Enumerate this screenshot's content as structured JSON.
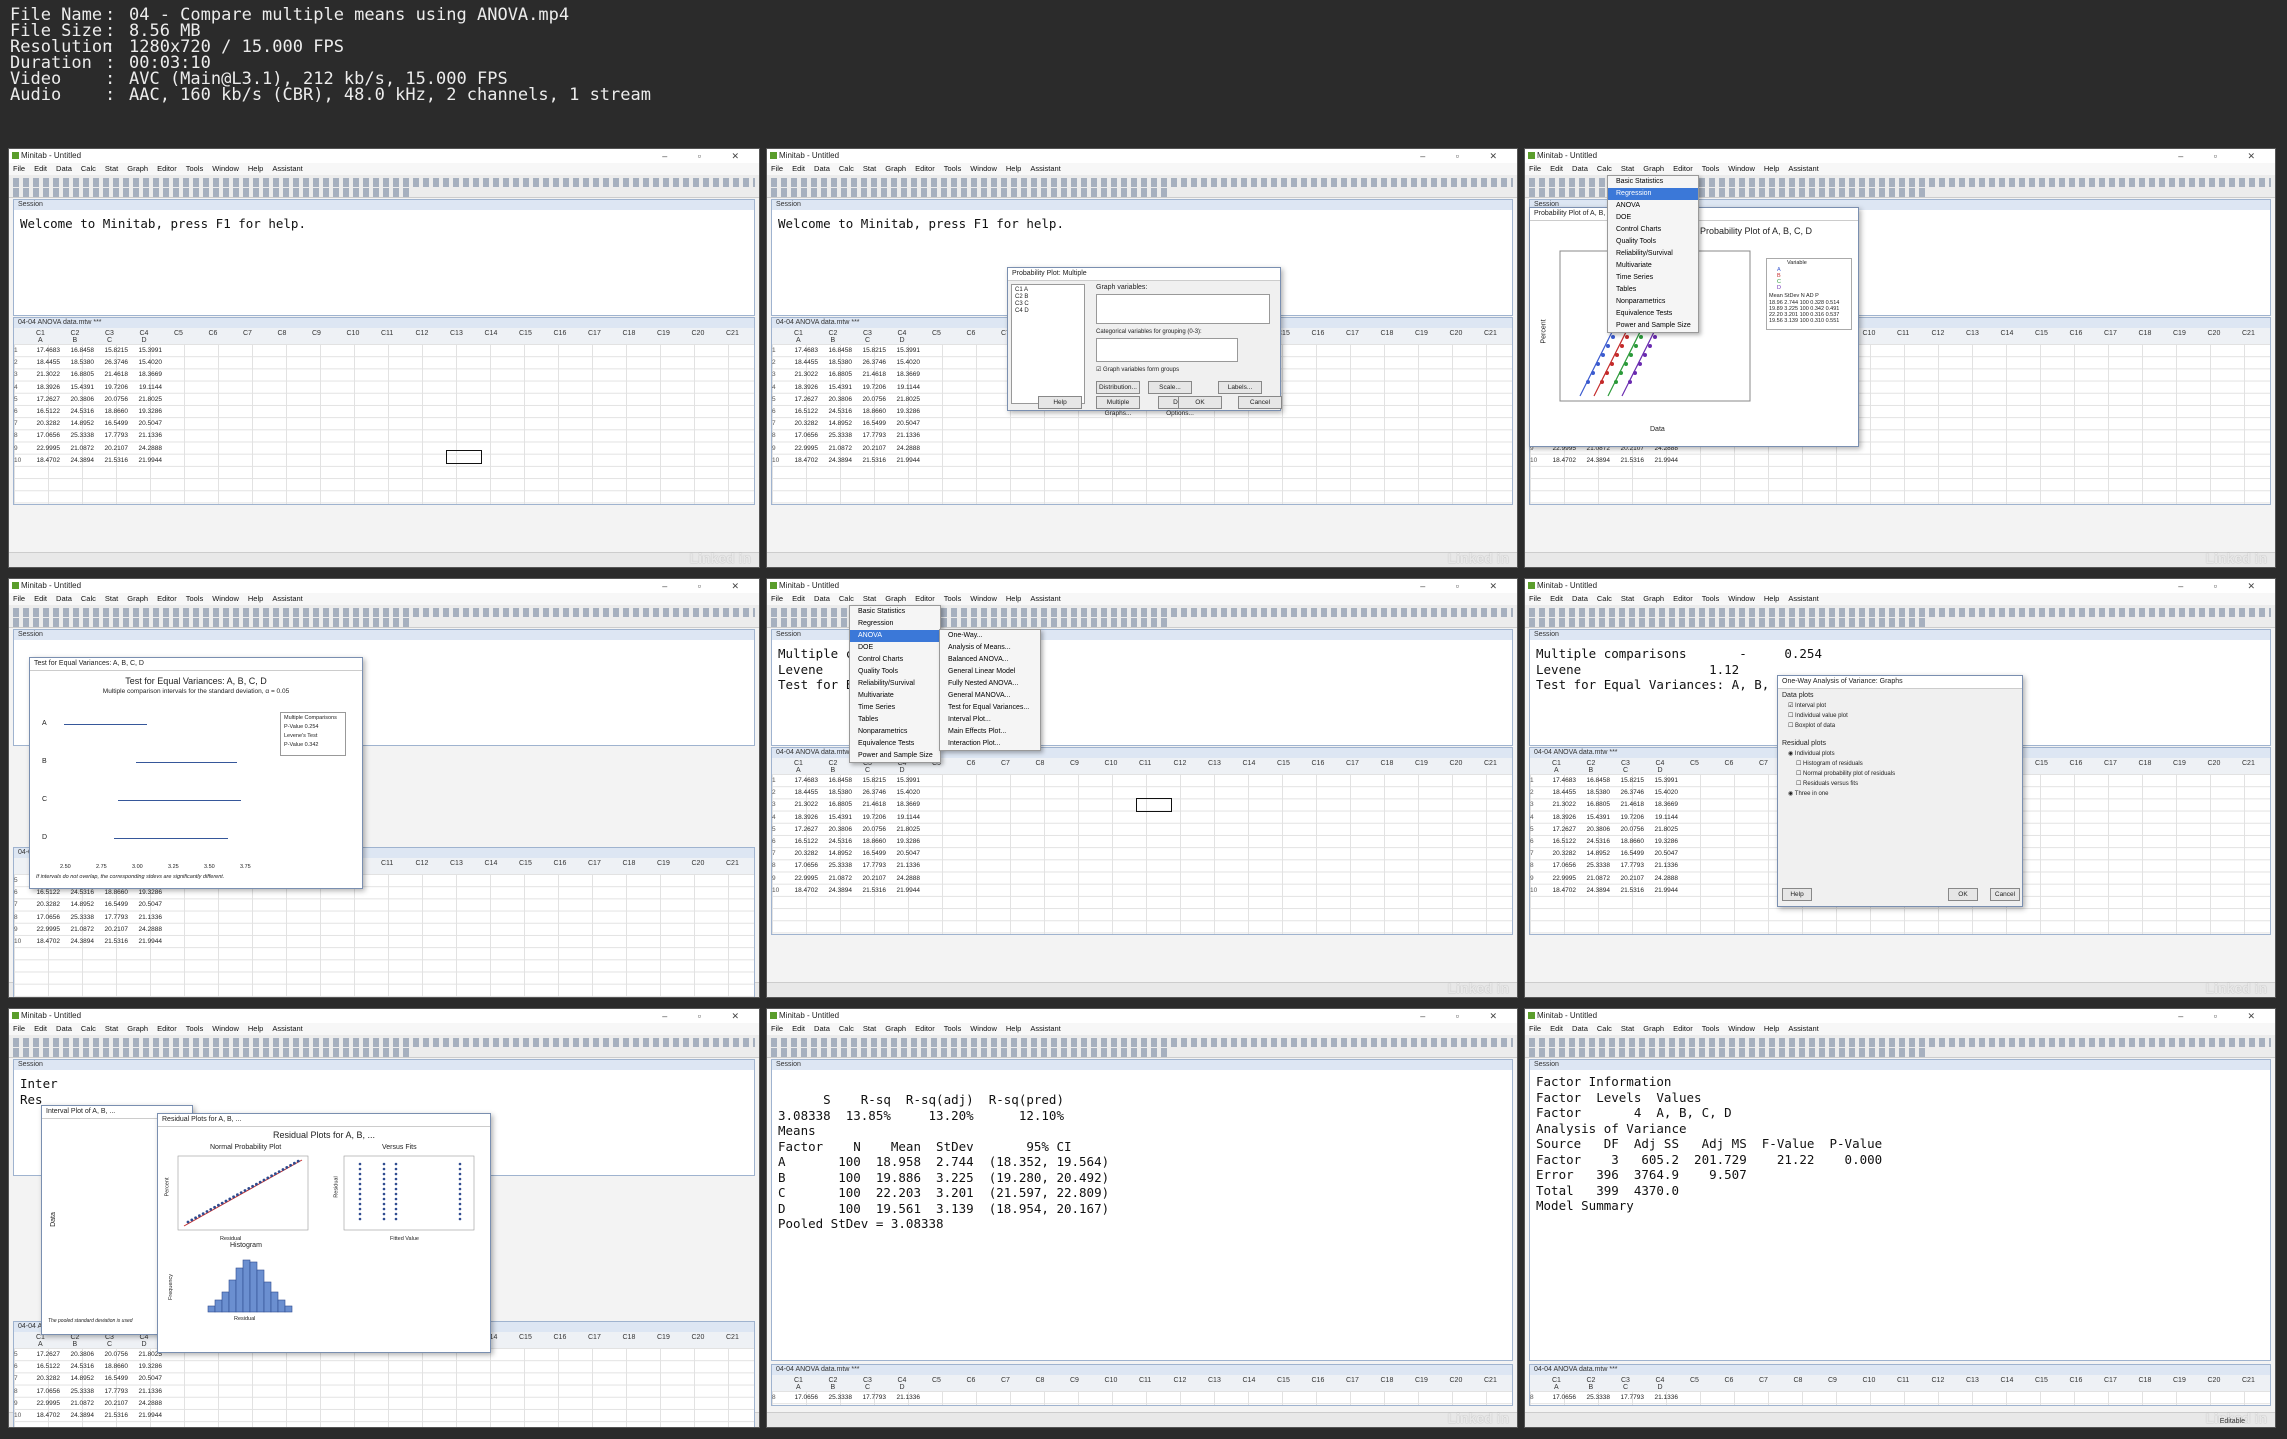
{
  "file_info": [
    {
      "key": "File Name",
      "value": "04 - Compare multiple means using ANOVA.mp4"
    },
    {
      "key": "File Size",
      "value": "8.56 MB"
    },
    {
      "key": "Resolution",
      "value": "1280x720 / 15.000 FPS"
    },
    {
      "key": "Duration",
      "value": "00:03:10"
    },
    {
      "key": "Video",
      "value": "AVC (Main@L3.1), 212 kb/s, 15.000 FPS"
    },
    {
      "key": "Audio",
      "value": "AAC, 160 kb/s (CBR), 48.0 kHz, 2 channels, 1 stream"
    }
  ],
  "app": {
    "title": "Minitab - Untitled",
    "menus": [
      "File",
      "Edit",
      "Data",
      "Calc",
      "Stat",
      "Graph",
      "Editor",
      "Tools",
      "Window",
      "Help",
      "Assistant"
    ],
    "session_title": "Session",
    "worksheet_title": "04-04 ANOVA data.mtw ***",
    "watermark": "Linked in"
  },
  "session_text": {
    "welcome": "Welcome to Minitab, press F1 for help.",
    "multiple": "Multiple comparisons",
    "levene": "Levene",
    "levene_val": "1.12",
    "pval": "0.254",
    "test_equal": "Test for Equal Variances: A, B,"
  },
  "worksheet": {
    "columns": [
      "C1",
      "C2",
      "C3",
      "C4",
      "C5",
      "C6",
      "C7",
      "C8",
      "C9",
      "C10",
      "C11",
      "C12",
      "C13",
      "C14",
      "C15",
      "C16",
      "C17",
      "C18",
      "C19",
      "C20",
      "C21"
    ],
    "names": [
      "A",
      "B",
      "C",
      "D"
    ],
    "rows": [
      [
        "1",
        "17.4683",
        "16.8458",
        "15.8215",
        "15.3991"
      ],
      [
        "2",
        "18.4455",
        "18.5380",
        "26.3746",
        "15.4020"
      ],
      [
        "3",
        "21.3022",
        "16.8805",
        "21.4618",
        "18.3669"
      ],
      [
        "4",
        "18.3926",
        "15.4391",
        "19.7206",
        "19.1144"
      ],
      [
        "5",
        "17.2627",
        "20.3806",
        "20.0756",
        "21.8025"
      ],
      [
        "6",
        "16.5122",
        "24.5316",
        "18.8660",
        "19.3286"
      ],
      [
        "7",
        "20.3282",
        "14.8952",
        "16.5499",
        "20.5047"
      ],
      [
        "8",
        "17.0656",
        "25.3338",
        "17.7793",
        "21.1336"
      ],
      [
        "9",
        "22.9995",
        "21.0872",
        "20.2107",
        "24.2888"
      ],
      [
        "10",
        "18.4702",
        "24.3894",
        "21.5316",
        "21.9944"
      ]
    ]
  },
  "stat_menu": [
    "Basic Statistics",
    "Regression",
    "ANOVA",
    "DOE",
    "Control Charts",
    "Quality Tools",
    "Reliability/Survival",
    "Multivariate",
    "Time Series",
    "Tables",
    "Nonparametrics",
    "Equivalence Tests",
    "Power and Sample Size"
  ],
  "anova_submenu": [
    "One-Way...",
    "Analysis of Means...",
    "Balanced ANOVA...",
    "General Linear Model",
    "Fully Nested ANOVA...",
    "General MANOVA...",
    "Test for Equal Variances...",
    "Interval Plot...",
    "Main Effects Plot...",
    "Interaction Plot..."
  ],
  "prob_dialog": {
    "title": "Probability Plot: Multiple",
    "vars": [
      "C1  A",
      "C2  B",
      "C3  C",
      "C4  D"
    ],
    "graph_vars": "Graph variables:",
    "cat_vars": "Categorical variables for grouping (0-3):",
    "check": "Graph variables form groups",
    "buttons": [
      "Distribution...",
      "Scale...",
      "Labels...",
      "Multiple Graphs...",
      "Data Options...",
      "Select",
      "Help",
      "OK",
      "Cancel"
    ]
  },
  "prob_plot": {
    "title": "Probability Plot of A, B, C, D",
    "xlabel": "Data",
    "ylabel": "Percent",
    "legend_title": "Variable",
    "legend": [
      "A",
      "B",
      "C",
      "D"
    ],
    "stats_header": [
      "Mean",
      "StDev",
      "N",
      "AD",
      "P"
    ],
    "stats": [
      [
        "18.96",
        "2.744",
        "100",
        "0.328",
        "0.514"
      ],
      [
        "19.89",
        "3.225",
        "100",
        "0.342",
        "0.491"
      ],
      [
        "22.20",
        "3.201",
        "100",
        "0.316",
        "0.537"
      ],
      [
        "19.56",
        "3.139",
        "100",
        "0.310",
        "0.551"
      ]
    ]
  },
  "equal_var": {
    "window_title": "Test for Equal Variances: A, B, C, D",
    "title": "Test for Equal Variances: A, B, C, D",
    "subtitle": "Multiple comparison intervals for the standard deviation, α = 0.05",
    "box": [
      "Multiple Comparisons",
      "P-Value   0.254",
      "Levene's Test",
      "P-Value   0.342"
    ],
    "groups": [
      "A",
      "B",
      "C",
      "D"
    ],
    "ticks": [
      "2.50",
      "2.75",
      "3.00",
      "3.25",
      "3.50",
      "3.75"
    ],
    "footnote": "If intervals do not overlap, the corresponding stdevs are significantly different."
  },
  "oneway_graphs": {
    "title": "One-Way Analysis of Variance: Graphs",
    "data_plots": "Data plots",
    "options1": [
      "Interval plot",
      "Individual value plot",
      "Boxplot of data"
    ],
    "resid_plots": "Residual plots",
    "options2": [
      "Individual plots",
      "Histogram of residuals",
      "Normal probability plot of residuals",
      "Residuals versus fits",
      "Three in one"
    ],
    "buttons": [
      "Help",
      "OK",
      "Cancel"
    ]
  },
  "residual": {
    "window_title": "Residual Plots for A, B, ...",
    "interval_title": "Interval Plot of A, B, ...",
    "title": "Residual Plots for A, B, ...",
    "npp": "Normal Probability Plot",
    "vfits": "Versus Fits",
    "hist": "Histogram",
    "xl1": "Residual",
    "xl2": "Fitted Value",
    "yl1": "Percent",
    "yl2": "Residual",
    "yl3": "Frequency",
    "data_label": "Data",
    "pooled_note": "The pooled standard deviation is used",
    "inter": "Inter",
    "res": "Res"
  },
  "summary": {
    "header": "      S    R-sq  R-sq(adj)  R-sq(pred)",
    "row": "3.08338  13.85%     13.20%      12.10%",
    "means": "Means",
    "mhead": "Factor    N    Mean  StDev       95% CI",
    "mrows": [
      "A       100  18.958  2.744  (18.352, 19.564)",
      "B       100  19.886  3.225  (19.280, 20.492)",
      "C       100  22.203  3.201  (21.597, 22.809)",
      "D       100  19.561  3.139  (18.954, 20.167)"
    ],
    "pooled": "Pooled StDev = 3.08338"
  },
  "anova_out": {
    "factor_info": "Factor Information",
    "fhead": "Factor  Levels  Values",
    "frow": "Factor       4  A, B, C, D",
    "aov": "Analysis of Variance",
    "ahead": "Source   DF  Adj SS   Adj MS  F-Value  P-Value",
    "arows": [
      "Factor    3   605.2  201.729    21.22    0.000",
      "Error   396  3764.9    9.507",
      "Total   399  4370.0"
    ],
    "model": "Model Summary"
  },
  "status": {
    "editable": "Editable"
  }
}
